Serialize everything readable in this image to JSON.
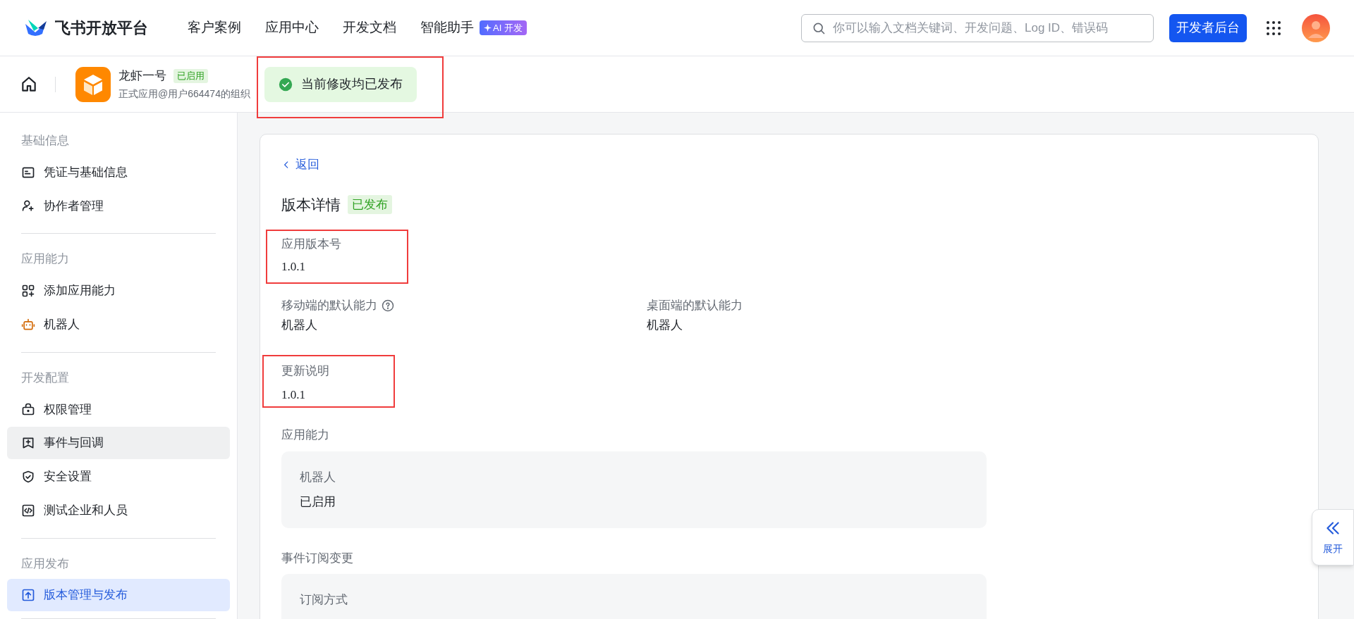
{
  "header": {
    "brand": "飞书开放平台",
    "nav": [
      {
        "label": "客户案例"
      },
      {
        "label": "应用中心"
      },
      {
        "label": "开发文档"
      },
      {
        "label": "智能助手",
        "badge": "AI 开发"
      }
    ],
    "search": {
      "placeholder": "你可以输入文档关键词、开发问题、Log ID、错误码"
    },
    "console_button": "开发者后台"
  },
  "app_bar": {
    "app_name": "龙虾一号",
    "status": "已启用",
    "subtitle": "正式应用@用户664474的组织",
    "toast": "当前修改均已发布",
    "toast_highlighted": true
  },
  "sidebar": {
    "groups": [
      {
        "title": "基础信息",
        "items": [
          {
            "label": "凭证与基础信息",
            "selected": false,
            "hovered": false
          },
          {
            "label": "协作者管理",
            "selected": false,
            "hovered": false
          }
        ]
      },
      {
        "title": "应用能力",
        "items": [
          {
            "label": "添加应用能力",
            "selected": false,
            "hovered": false
          },
          {
            "label": "机器人",
            "selected": false,
            "hovered": false
          }
        ]
      },
      {
        "title": "开发配置",
        "items": [
          {
            "label": "权限管理",
            "selected": false,
            "hovered": false
          },
          {
            "label": "事件与回调",
            "selected": false,
            "hovered": true
          },
          {
            "label": "安全设置",
            "selected": false,
            "hovered": false
          },
          {
            "label": "测试企业和人员",
            "selected": false,
            "hovered": false
          }
        ]
      },
      {
        "title": "应用发布",
        "items": [
          {
            "label": "版本管理与发布",
            "selected": true,
            "hovered": false
          }
        ]
      }
    ]
  },
  "detail": {
    "back": "返回",
    "title": "版本详情",
    "status": "已发布",
    "version": {
      "label": "应用版本号",
      "value": "1.0.1",
      "highlighted": true
    },
    "defaults": [
      {
        "label": "移动端的默认能力",
        "help": true,
        "value": "机器人"
      },
      {
        "label": "桌面端的默认能力",
        "help": false,
        "value": "机器人"
      }
    ],
    "notes": {
      "label": "更新说明",
      "value": "1.0.1",
      "highlighted": true
    },
    "sections": [
      {
        "title": "应用能力",
        "box_label": "机器人",
        "box_value": "已启用"
      },
      {
        "title": "事件订阅变更",
        "box_label": "订阅方式"
      }
    ]
  },
  "expand_button": {
    "label": "展开"
  }
}
